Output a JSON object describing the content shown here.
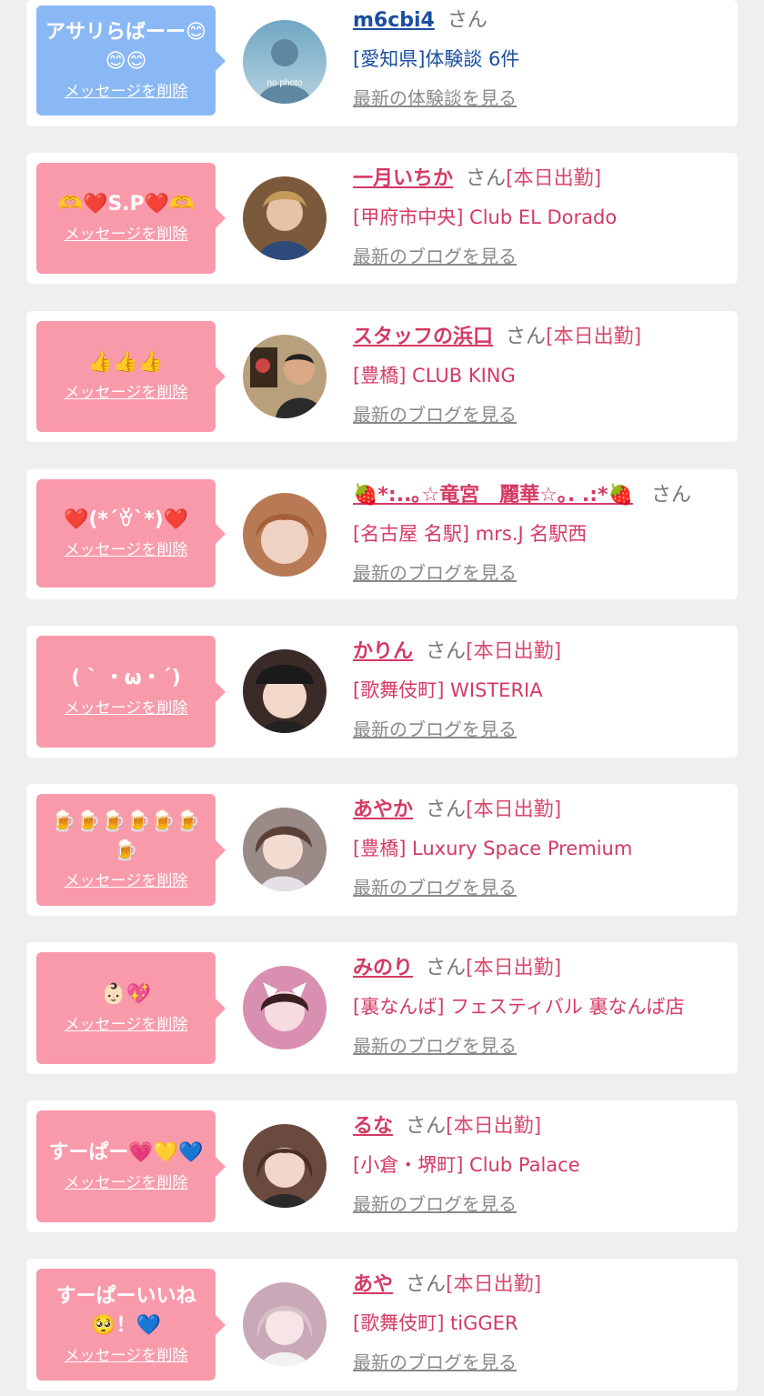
{
  "theme": {
    "blue_bubble": "#8ab8f4",
    "pink_bubble": "#f99aab",
    "blue_text": "#1a4fa0",
    "pink_text": "#d43a63"
  },
  "entries": [
    {
      "type": "user",
      "message": "アサリらばーー😊😊😊",
      "delete_label": "メッセージを削除",
      "name": "m6cbi4",
      "honorific": "さん",
      "work_status": "",
      "store": "[愛知県]体験談 6件",
      "latest_link": "最新の体験談を見る",
      "avatar_text": "no photo",
      "avatar_color": "#8fb8cf"
    },
    {
      "type": "cast",
      "message": "🫶❤️S.P❤️🫶",
      "delete_label": "メッセージを削除",
      "name": "一月いちか",
      "honorific": "さん",
      "work_status": "[本日出勤]",
      "store": "[甲府市中央] Club EL Dorado",
      "latest_link": "最新のブログを見る",
      "avatar_color": "#7b5a3c"
    },
    {
      "type": "cast",
      "message": "👍👍👍",
      "delete_label": "メッセージを削除",
      "name": "スタッフの浜口",
      "honorific": "さん",
      "work_status": "[本日出勤]",
      "store": "[豊橋] CLUB KING",
      "latest_link": "最新のブログを見る",
      "avatar_color": "#5a4a3a"
    },
    {
      "type": "cast",
      "message": "❤️(*´ꈊ`*)❤️",
      "delete_label": "メッセージを削除",
      "name": "🍓*:..｡☆竜宮　麗華☆｡. .:*🍓",
      "honorific": "さん",
      "work_status": "",
      "store": "[名古屋 名駅] mrs.J 名駅西",
      "latest_link": "最新のブログを見る",
      "avatar_color": "#b77a55"
    },
    {
      "type": "cast",
      "message": "( ˋ ・ω・ˊ)",
      "delete_label": "メッセージを削除",
      "name": "かりん",
      "honorific": "さん",
      "work_status": "[本日出勤]",
      "store": "[歌舞伎町] WISTERIA",
      "latest_link": "最新のブログを見る",
      "avatar_color": "#3a2a28"
    },
    {
      "type": "cast",
      "message": "🍺🍺🍺🍺🍺🍺🍺",
      "delete_label": "メッセージを削除",
      "name": "あやか",
      "honorific": "さん",
      "work_status": "[本日出勤]",
      "store": "[豊橋] Luxury Space Premium",
      "latest_link": "最新のブログを見る",
      "avatar_color": "#9a8a88"
    },
    {
      "type": "cast",
      "message": "👶🏻💖",
      "delete_label": "メッセージを削除",
      "name": "みのり",
      "honorific": "さん",
      "work_status": "[本日出勤]",
      "store": "[裏なんば] フェスティバル 裏なんば店",
      "latest_link": "最新のブログを見る",
      "avatar_color": "#d98fb0"
    },
    {
      "type": "cast",
      "message": "すーぱー💗💛💙",
      "delete_label": "メッセージを削除",
      "name": "るな",
      "honorific": "さん",
      "work_status": "[本日出勤]",
      "store": "[小倉・堺町] Club Palace",
      "latest_link": "最新のブログを見る",
      "avatar_color": "#6a4a3e"
    },
    {
      "type": "cast",
      "message": "すーぱーいいね🥺！💙",
      "delete_label": "メッセージを削除",
      "name": "あや",
      "honorific": "さん",
      "work_status": "[本日出勤]",
      "store": "[歌舞伎町] tiGGER",
      "latest_link": "最新のブログを見る",
      "avatar_color": "#c9a9b8"
    }
  ]
}
